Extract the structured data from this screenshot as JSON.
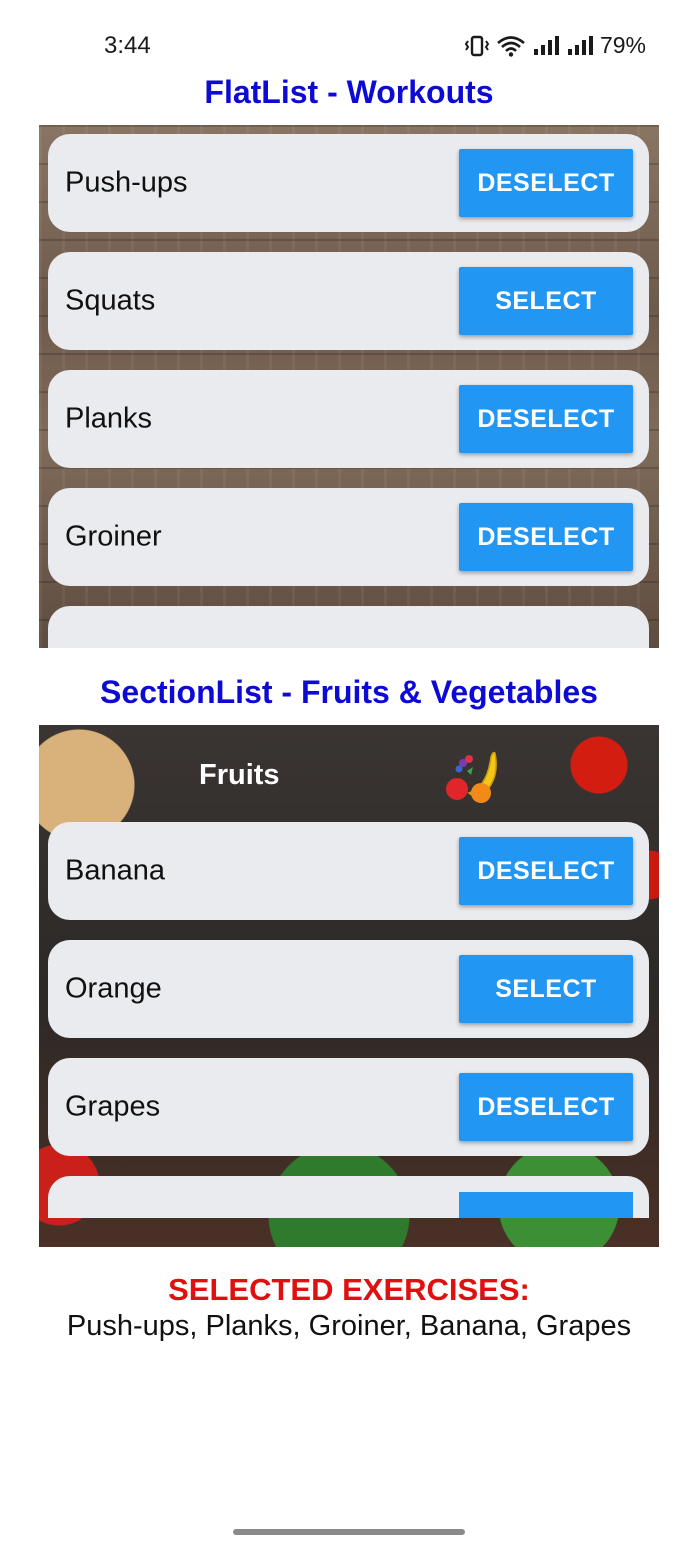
{
  "status_bar": {
    "time": "3:44",
    "battery": "79%"
  },
  "flatlist": {
    "title": "FlatList - Workouts",
    "items": [
      {
        "label": "Push-ups",
        "button": "DESELECT"
      },
      {
        "label": "Squats",
        "button": "SELECT"
      },
      {
        "label": "Planks",
        "button": "DESELECT"
      },
      {
        "label": "Groiner",
        "button": "DESELECT"
      }
    ]
  },
  "sectionlist": {
    "title": "SectionList - Fruits & Vegetables",
    "section_header": "Fruits",
    "section_icon": "fruit-icon",
    "items": [
      {
        "label": "Banana",
        "button": "DESELECT"
      },
      {
        "label": "Orange",
        "button": "SELECT"
      },
      {
        "label": "Grapes",
        "button": "DESELECT"
      }
    ]
  },
  "selected": {
    "heading": "SELECTED EXERCISES:",
    "values": "Push-ups, Planks, Groiner, Banana, Grapes"
  },
  "colors": {
    "title": "#0d0ad6",
    "button": "#2196f3",
    "selected_heading": "#e01010"
  }
}
